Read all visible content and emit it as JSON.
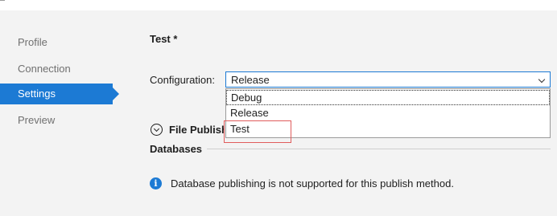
{
  "sidebar": {
    "items": [
      {
        "label": "Profile",
        "active": false
      },
      {
        "label": "Connection",
        "active": false
      },
      {
        "label": "Settings",
        "active": true
      },
      {
        "label": "Preview",
        "active": false
      }
    ]
  },
  "main": {
    "title": "Test *",
    "configuration": {
      "label": "Configuration:",
      "selected_value": "Release",
      "options": [
        "Debug",
        "Release",
        "Test"
      ]
    },
    "file_publish_label": "File Publish",
    "databases_label": "Databases",
    "info_message": "Database publishing is not supported for this publish method."
  },
  "colors": {
    "accent": "#1c7ad4",
    "background": "#f3f3f3",
    "highlight_box": "#e05c5c"
  },
  "icons": {
    "expand": "chevron-down-circle-icon",
    "info": "info-icon",
    "select_arrow": "chevron-down-icon"
  }
}
